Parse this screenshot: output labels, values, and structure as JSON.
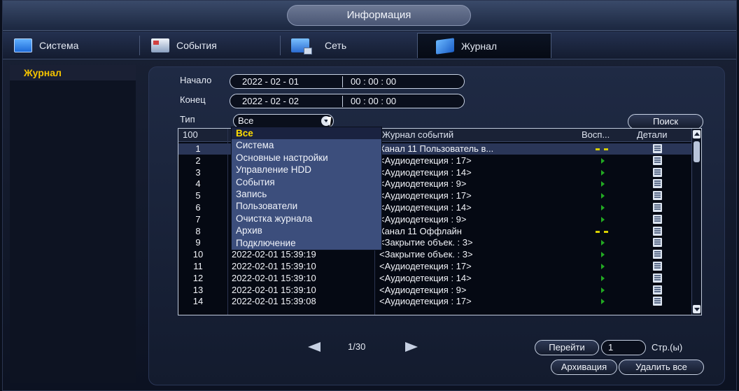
{
  "window": {
    "title": "Информация"
  },
  "tabs": [
    {
      "label": "Система",
      "icon": "system-icon"
    },
    {
      "label": "События",
      "icon": "events-icon"
    },
    {
      "label": "Сеть",
      "icon": "network-icon"
    },
    {
      "label": "Журнал",
      "icon": "log-icon",
      "active": true
    }
  ],
  "sidebar": {
    "items": [
      {
        "label": "Журнал",
        "active": true
      }
    ]
  },
  "filter": {
    "start_label": "Начало",
    "start_date": "2022 - 02 - 01",
    "start_time": "00 : 00 : 00",
    "end_label": "Конец",
    "end_date": "2022 - 02 - 02",
    "end_time": "00 : 00 : 00",
    "type_label": "Тип",
    "type_value": "Все",
    "search_label": "Поиск"
  },
  "dropdown": {
    "options": [
      "Все",
      "Система",
      "Основные настройки",
      "Управление HDD",
      "События",
      "Запись",
      "Пользователи",
      "Очистка журнала",
      "Архив",
      "Подключение"
    ],
    "highlighted": "Все"
  },
  "table": {
    "headers": {
      "count": "100",
      "event": "Журнал событий",
      "playback": "Восп...",
      "details": "Детали"
    },
    "rows": [
      {
        "n": "1",
        "time": "",
        "event": "Канал 11 Пользователь в...",
        "pb": "dash",
        "selected": true
      },
      {
        "n": "2",
        "time": "",
        "event": "<Аудиодетекция : 17>",
        "pb": "play"
      },
      {
        "n": "3",
        "time": "",
        "event": "<Аудиодетекция : 14>",
        "pb": "play"
      },
      {
        "n": "4",
        "time": "",
        "event": "<Аудиодетекция : 9>",
        "pb": "play"
      },
      {
        "n": "5",
        "time": "",
        "event": "<Аудиодетекция : 17>",
        "pb": "play"
      },
      {
        "n": "6",
        "time": "",
        "event": "<Аудиодетекция : 14>",
        "pb": "play"
      },
      {
        "n": "7",
        "time": "",
        "event": "<Аудиодетекция : 9>",
        "pb": "play"
      },
      {
        "n": "8",
        "time": "",
        "event": "Канал 11 Оффлайн",
        "pb": "dash"
      },
      {
        "n": "9",
        "time": "",
        "event": "<Закрытие объек. : 3>",
        "pb": "play"
      },
      {
        "n": "10",
        "time": "2022-02-01 15:39:19",
        "event": "<Закрытие объек. : 3>",
        "pb": "play"
      },
      {
        "n": "11",
        "time": "2022-02-01 15:39:10",
        "event": "<Аудиодетекция : 17>",
        "pb": "play"
      },
      {
        "n": "12",
        "time": "2022-02-01 15:39:10",
        "event": "<Аудиодетекция : 14>",
        "pb": "play"
      },
      {
        "n": "13",
        "time": "2022-02-01 15:39:10",
        "event": "<Аудиодетекция : 9>",
        "pb": "play"
      },
      {
        "n": "14",
        "time": "2022-02-01 15:39:08",
        "event": "<Аудиодетекция : 17>",
        "pb": "play"
      }
    ]
  },
  "pager": {
    "page": "1/30",
    "goto_label": "Перейти",
    "goto_value": "1",
    "pages_label": "Стр.(ы)"
  },
  "actions": {
    "backup_label": "Архивация",
    "clear_label": "Удалить все"
  },
  "colors": {
    "accent_yellow": "#f5c400",
    "play_green": "#22aa22",
    "panel": "#1f2a44"
  }
}
